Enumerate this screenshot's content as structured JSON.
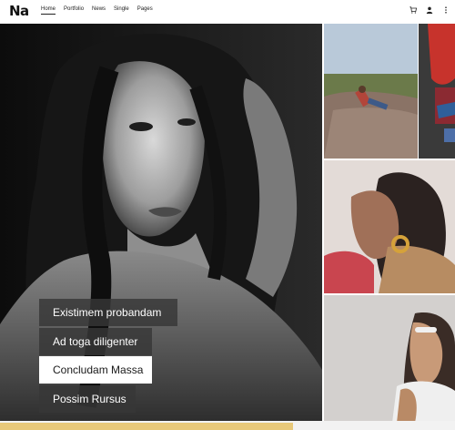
{
  "brand": {
    "logo_text": "Na"
  },
  "nav": {
    "items": [
      {
        "label": "Home",
        "active": true
      },
      {
        "label": "Portfolio",
        "active": false
      },
      {
        "label": "News",
        "active": false
      },
      {
        "label": "Single",
        "active": false
      },
      {
        "label": "Pages",
        "active": false
      }
    ]
  },
  "header_icons": [
    "cart-icon",
    "user-icon",
    "more-vertical-icon"
  ],
  "hero": {
    "menu": [
      {
        "label": "Existimem probandam",
        "highlighted": false
      },
      {
        "label": "Ad toga diligenter",
        "highlighted": false
      },
      {
        "label": "Concludam Massa",
        "highlighted": true
      },
      {
        "label": "Possim Rursus",
        "highlighted": false
      }
    ]
  },
  "colors": {
    "accent": "#e8c97a",
    "menu_bg": "#373737",
    "highlight_bg": "#ffffff"
  }
}
